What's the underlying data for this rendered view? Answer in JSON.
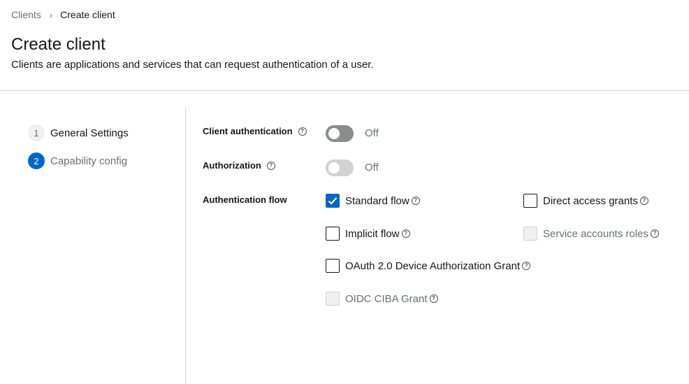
{
  "breadcrumb": {
    "parent": "Clients",
    "separator": "›",
    "current": "Create client"
  },
  "header": {
    "title": "Create client",
    "description": "Clients are applications and services that can request authentication of a user."
  },
  "wizard": {
    "steps": [
      {
        "number": "1",
        "label": "General Settings",
        "state": "completed"
      },
      {
        "number": "2",
        "label": "Capability config",
        "state": "current"
      }
    ]
  },
  "form": {
    "client_authentication": {
      "label": "Client authentication",
      "value": "Off",
      "enabled": true
    },
    "authorization": {
      "label": "Authorization",
      "value": "Off",
      "enabled": false
    },
    "authentication_flow": {
      "label": "Authentication flow",
      "options": [
        {
          "label": "Standard flow",
          "checked": true,
          "disabled": false
        },
        {
          "label": "Direct access grants",
          "checked": false,
          "disabled": false
        },
        {
          "label": "Implicit flow",
          "checked": false,
          "disabled": false
        },
        {
          "label": "Service accounts roles",
          "checked": false,
          "disabled": true
        },
        {
          "label": "OAuth 2.0 Device Authorization Grant",
          "checked": false,
          "disabled": false
        },
        {
          "label": "OIDC CIBA Grant",
          "checked": false,
          "disabled": true
        }
      ]
    }
  },
  "icons": {
    "help": "help-circle-icon",
    "check": "checkmark-icon"
  },
  "colors": {
    "accent": "#0066cc",
    "switch_off": "#8a8d90",
    "switch_disabled": "#d2d2d2",
    "muted_text": "#6a6e73"
  }
}
